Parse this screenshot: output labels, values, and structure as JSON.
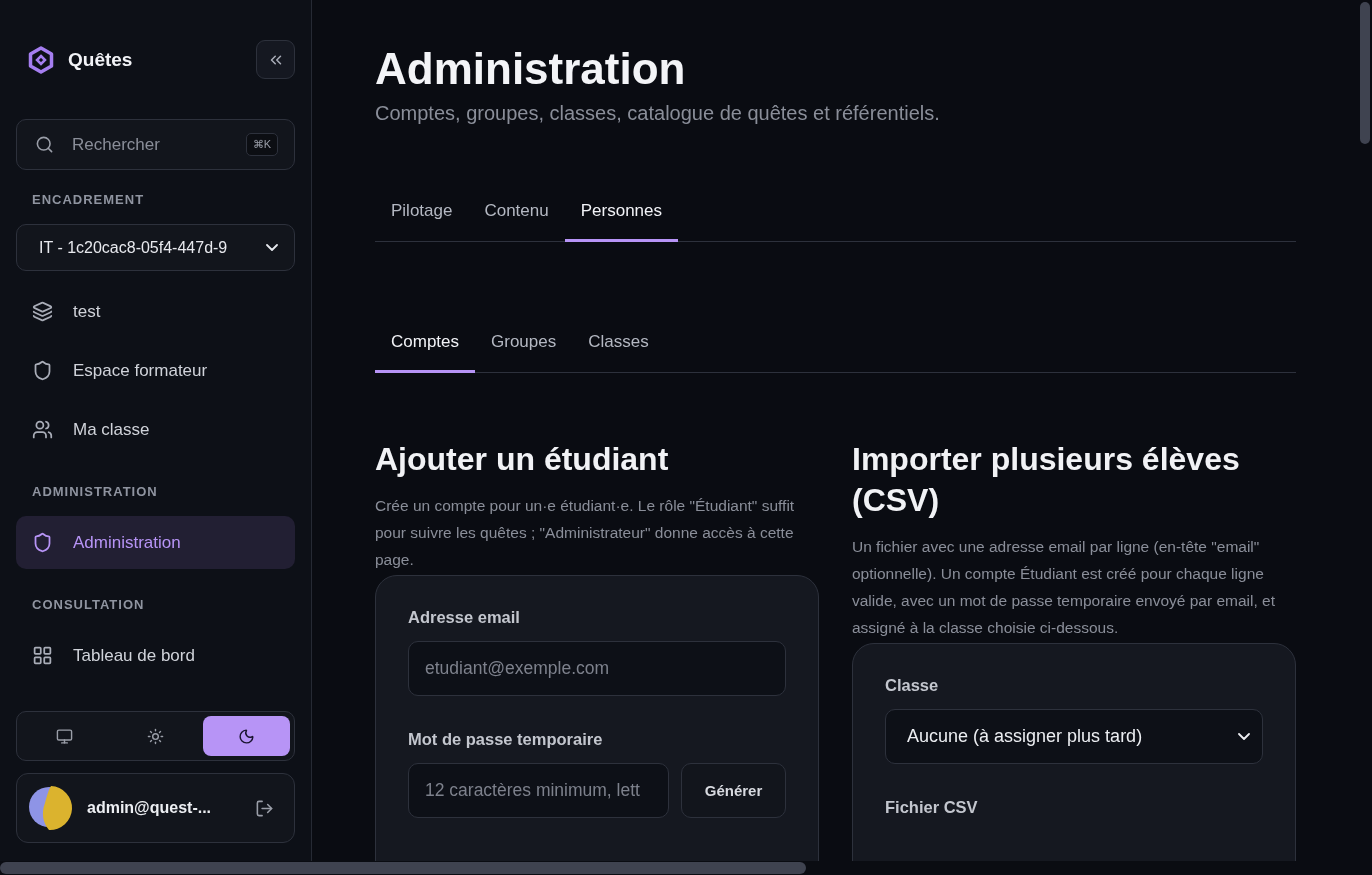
{
  "sidebar": {
    "brand": "Quêtes",
    "search": {
      "placeholder": "Rechercher",
      "shortcut": "⌘K"
    },
    "sections": [
      {
        "label": "ENCADREMENT",
        "select": {
          "value": "IT - 1c20cac8-05f4-447d-9"
        },
        "items": [
          {
            "label": "test",
            "selected": false
          },
          {
            "label": "Espace formateur",
            "selected": false
          },
          {
            "label": "Ma classe",
            "selected": false
          }
        ]
      },
      {
        "label": "ADMINISTRATION",
        "items": [
          {
            "label": "Administration",
            "selected": true
          }
        ]
      },
      {
        "label": "CONSULTATION",
        "items": [
          {
            "label": "Tableau de bord",
            "selected": false
          }
        ]
      }
    ],
    "theme": [
      {
        "selected": false
      },
      {
        "selected": false
      },
      {
        "selected": true
      }
    ],
    "user": {
      "email": "admin@quest-..."
    }
  },
  "page": {
    "title": "Administration",
    "subtitle": "Comptes, groupes, classes, catalogue de quêtes et référentiels.",
    "tabs": [
      {
        "label": "Pilotage",
        "selected": false
      },
      {
        "label": "Contenu",
        "selected": false
      },
      {
        "label": "Personnes",
        "selected": true
      }
    ],
    "subtabs": [
      {
        "label": "Comptes",
        "selected": true
      },
      {
        "label": "Groupes",
        "selected": false
      },
      {
        "label": "Classes",
        "selected": false
      }
    ],
    "add_student": {
      "title": "Ajouter un étudiant",
      "description": "Crée un compte pour un·e étudiant·e. Le rôle \"Étudiant\" suffit pour suivre les quêtes ; \"Administrateur\" donne accès à cette page.",
      "email": {
        "label": "Adresse email",
        "placeholder": "etudiant@exemple.com"
      },
      "password": {
        "label": "Mot de passe temporaire",
        "placeholder": "12 caractères minimum, lett",
        "button": "Générer"
      }
    },
    "import": {
      "title": "Importer plusieurs élèves (CSV)",
      "description": "Un fichier avec une adresse email par ligne (en-tête \"email\" optionnelle). Un compte Étudiant est créé pour chaque ligne valide, avec un mot de passe temporaire envoyé par email, et assigné à la classe choisie ci-dessous.",
      "class": {
        "label": "Classe",
        "value": "Aucune (à assigner plus tard)"
      },
      "file": {
        "label": "Fichier CSV"
      }
    }
  }
}
